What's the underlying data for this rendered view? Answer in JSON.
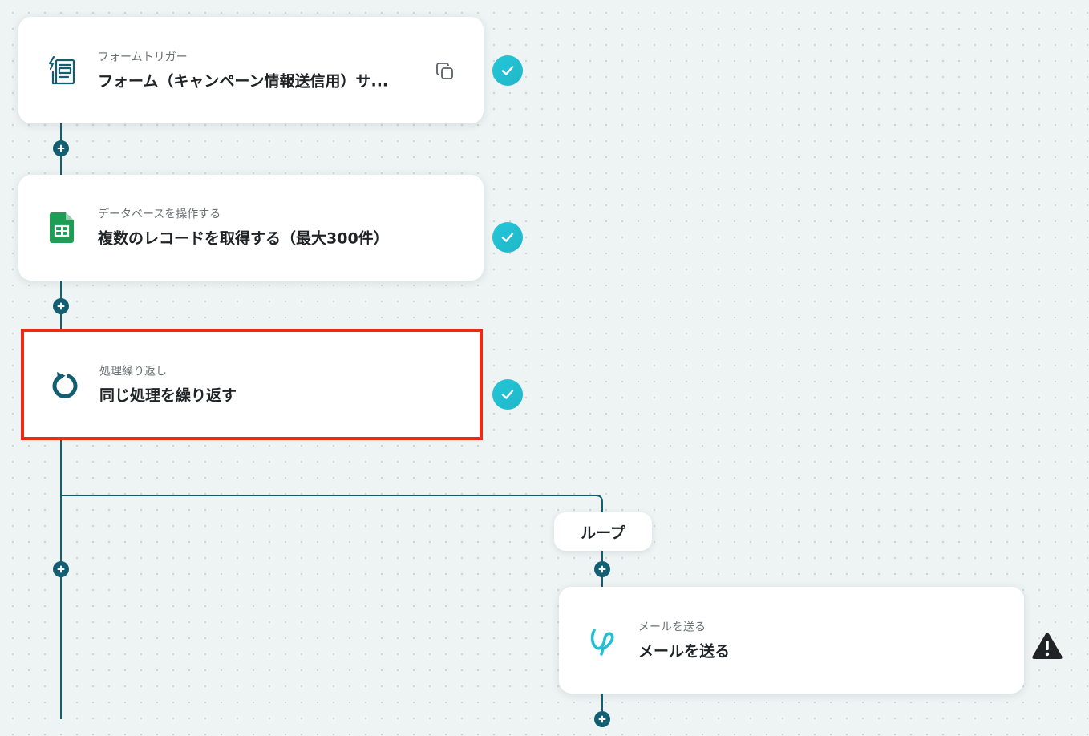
{
  "steps": [
    {
      "subtitle": "フォームトリガー",
      "title": "フォーム（キャンペーン情報送信用）サ...",
      "icon": "form-trigger-icon",
      "status": "completed"
    },
    {
      "subtitle": "データベースを操作する",
      "title": "複数のレコードを取得する（最大300件）",
      "icon": "google-sheets-icon",
      "status": "completed"
    },
    {
      "subtitle": "処理繰り返し",
      "title": "同じ処理を繰り返す",
      "icon": "loop-icon",
      "status": "completed",
      "selected": true
    }
  ],
  "loop": {
    "label": "ループ"
  },
  "loop_steps": [
    {
      "subtitle": "メールを送る",
      "title": "メールを送る",
      "icon": "mail-logo-icon",
      "status": "warning"
    }
  ],
  "colors": {
    "connector": "#145e71",
    "check_badge": "#22c0d3",
    "selected_border": "#f02a12",
    "sheets_green": "#1f9d55"
  }
}
